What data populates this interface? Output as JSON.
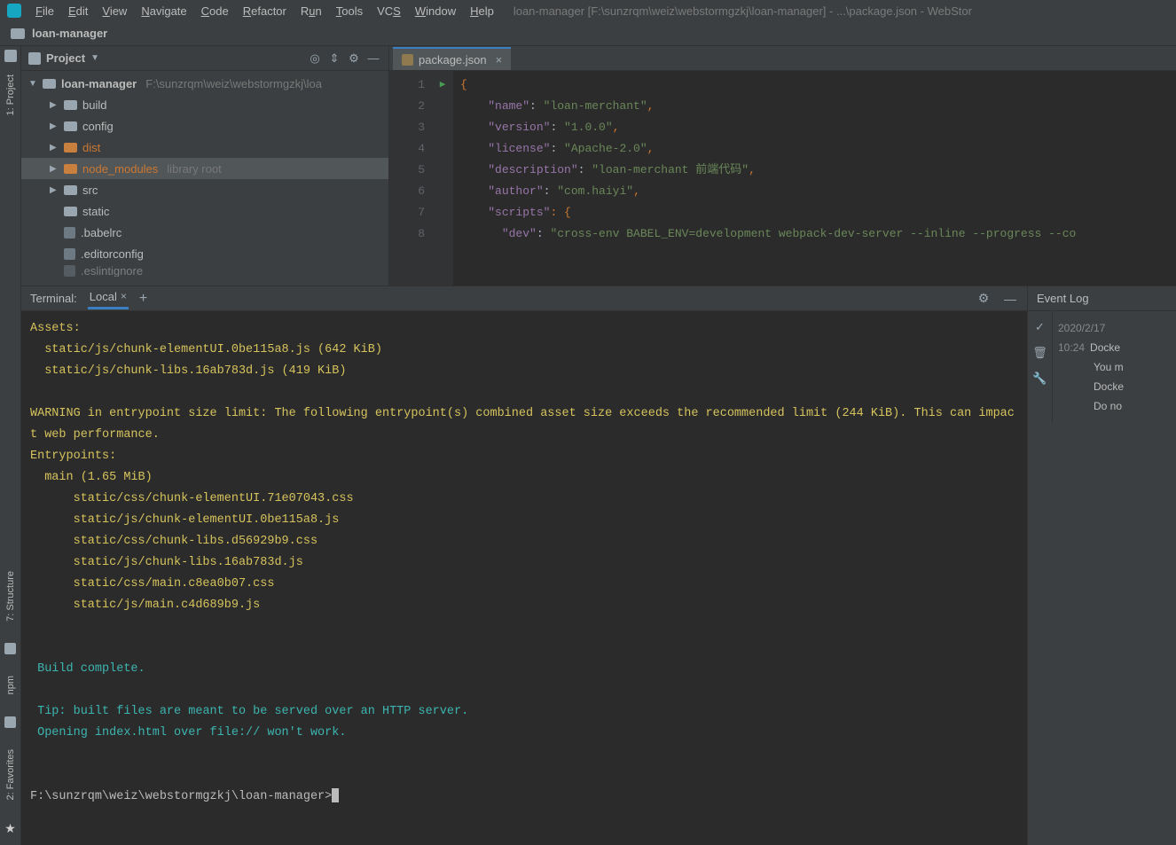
{
  "menubar": {
    "items": [
      {
        "label": "File",
        "u": "F"
      },
      {
        "label": "Edit",
        "u": "E"
      },
      {
        "label": "View",
        "u": "V"
      },
      {
        "label": "Navigate",
        "u": "N"
      },
      {
        "label": "Code",
        "u": "C"
      },
      {
        "label": "Refactor",
        "u": "R"
      },
      {
        "label": "Run",
        "u": "u"
      },
      {
        "label": "Tools",
        "u": "T"
      },
      {
        "label": "VCS",
        "u": "S"
      },
      {
        "label": "Window",
        "u": "W"
      },
      {
        "label": "Help",
        "u": "H"
      }
    ],
    "title": "loan-manager [F:\\sunzrqm\\weiz\\webstormgzkj\\loan-manager] - ...\\package.json - WebStor"
  },
  "breadcrumb": {
    "project": "loan-manager"
  },
  "left_tools": {
    "project": "1: Project",
    "structure": "7: Structure",
    "npm": "npm",
    "favorites": "2: Favorites"
  },
  "project_panel": {
    "title": "Project",
    "root": {
      "name": "loan-manager",
      "path": "F:\\sunzrqm\\weiz\\webstormgzkj\\loa"
    },
    "folders": [
      {
        "name": "build",
        "type": "folder"
      },
      {
        "name": "config",
        "type": "folder"
      },
      {
        "name": "dist",
        "type": "folder",
        "orange": true
      },
      {
        "name": "node_modules",
        "type": "folder",
        "orange": true,
        "extra": "library root",
        "highlight": true
      },
      {
        "name": "src",
        "type": "folder"
      },
      {
        "name": "static",
        "type": "folder",
        "noarrow": true
      },
      {
        "name": ".babelrc",
        "type": "file"
      },
      {
        "name": ".editorconfig",
        "type": "file"
      },
      {
        "name": ".eslintignore",
        "type": "file",
        "cut": true
      }
    ]
  },
  "editor": {
    "tab": {
      "name": "package.json"
    },
    "lines": [
      {
        "n": 1,
        "content": [
          {
            "t": "{",
            "c": "punct"
          }
        ]
      },
      {
        "n": 2,
        "content": [
          {
            "t": "    "
          },
          {
            "t": "\"name\"",
            "c": "key"
          },
          {
            "t": ": "
          },
          {
            "t": "\"loan-merchant\"",
            "c": "str"
          },
          {
            "t": ",",
            "c": "punct"
          }
        ]
      },
      {
        "n": 3,
        "content": [
          {
            "t": "    "
          },
          {
            "t": "\"version\"",
            "c": "key"
          },
          {
            "t": ": "
          },
          {
            "t": "\"1.0.0\"",
            "c": "str"
          },
          {
            "t": ",",
            "c": "punct"
          }
        ]
      },
      {
        "n": 4,
        "content": [
          {
            "t": "    "
          },
          {
            "t": "\"license\"",
            "c": "key"
          },
          {
            "t": ": "
          },
          {
            "t": "\"Apache-2.0\"",
            "c": "str"
          },
          {
            "t": ",",
            "c": "punct"
          }
        ]
      },
      {
        "n": 5,
        "content": [
          {
            "t": "    "
          },
          {
            "t": "\"description\"",
            "c": "key"
          },
          {
            "t": ": "
          },
          {
            "t": "\"loan-merchant 前端代码\"",
            "c": "str"
          },
          {
            "t": ",",
            "c": "punct"
          }
        ]
      },
      {
        "n": 6,
        "content": [
          {
            "t": "    "
          },
          {
            "t": "\"author\"",
            "c": "key"
          },
          {
            "t": ": "
          },
          {
            "t": "\"com.haiyi\"",
            "c": "str"
          },
          {
            "t": ",",
            "c": "punct"
          }
        ]
      },
      {
        "n": 7,
        "content": [
          {
            "t": "    "
          },
          {
            "t": "\"scripts\"",
            "c": "key"
          },
          {
            "t": ": {",
            "c": "punct"
          }
        ]
      },
      {
        "n": 8,
        "run": true,
        "content": [
          {
            "t": "      "
          },
          {
            "t": "\"dev\"",
            "c": "key"
          },
          {
            "t": ": "
          },
          {
            "t": "\"cross-env BABEL_ENV=development webpack-dev-server --inline --progress --co",
            "c": "str"
          }
        ]
      }
    ]
  },
  "terminal": {
    "label": "Terminal:",
    "tab": "Local",
    "lines": [
      {
        "text": "Assets:",
        "c": "t-yellow"
      },
      {
        "text": "  static/js/chunk-elementUI.0be115a8.js (642 KiB)",
        "c": "t-yellow"
      },
      {
        "text": "  static/js/chunk-libs.16ab783d.js (419 KiB)",
        "c": "t-yellow"
      },
      {
        "text": "",
        "c": ""
      },
      {
        "text": "WARNING in entrypoint size limit: The following entrypoint(s) combined asset size exceeds the recommended limit (244 KiB). This can impact web performance.",
        "c": "t-yellow"
      },
      {
        "text": "Entrypoints:",
        "c": "t-yellow"
      },
      {
        "text": "  main (1.65 MiB)",
        "c": "t-yellow"
      },
      {
        "text": "      static/css/chunk-elementUI.71e07043.css",
        "c": "t-yellow"
      },
      {
        "text": "      static/js/chunk-elementUI.0be115a8.js",
        "c": "t-yellow"
      },
      {
        "text": "      static/css/chunk-libs.d56929b9.css",
        "c": "t-yellow"
      },
      {
        "text": "      static/js/chunk-libs.16ab783d.js",
        "c": "t-yellow"
      },
      {
        "text": "      static/css/main.c8ea0b07.css",
        "c": "t-yellow"
      },
      {
        "text": "      static/js/main.c4d689b9.js",
        "c": "t-yellow"
      },
      {
        "text": "",
        "c": ""
      },
      {
        "text": "",
        "c": ""
      },
      {
        "text": " Build complete.",
        "c": "t-cyan"
      },
      {
        "text": "",
        "c": ""
      },
      {
        "text": " Tip: built files are meant to be served over an HTTP server.",
        "c": "t-cyan"
      },
      {
        "text": " Opening index.html over file:// won't work.",
        "c": "t-cyan"
      },
      {
        "text": "",
        "c": ""
      },
      {
        "text": "",
        "c": ""
      }
    ],
    "prompt": "F:\\sunzrqm\\weiz\\webstormgzkj\\loan-manager>"
  },
  "eventlog": {
    "title": "Event Log",
    "date": "2020/2/17",
    "entries": [
      {
        "time": "10:24",
        "text": "Docke"
      },
      {
        "time": "",
        "text": "You m"
      },
      {
        "time": "",
        "text": "Docke"
      },
      {
        "time": "",
        "text": "Do no"
      }
    ]
  }
}
